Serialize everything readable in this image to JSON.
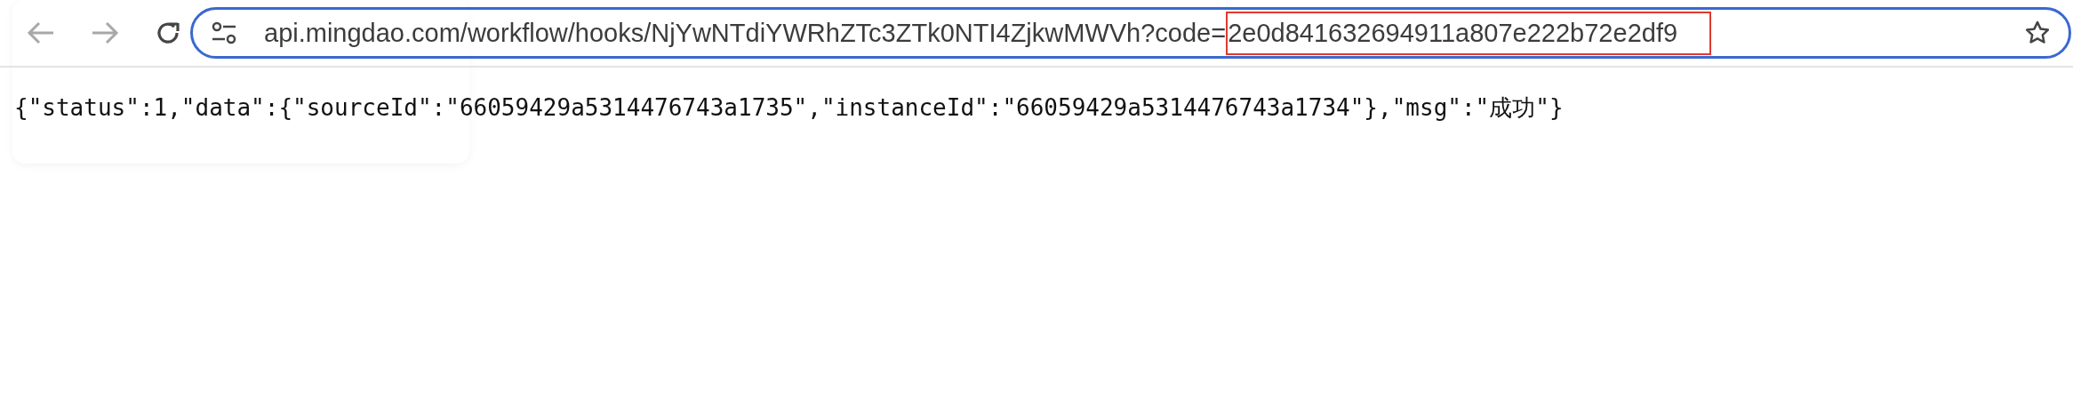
{
  "toolbar": {
    "url_prefix": "api.mingdao.com/workflow/hooks/NjYwNTdiYWRhZTc3ZTk0NTI4ZjkwMWVh?code=",
    "url_highlight": "2e0d841632694911a807e222b72e2df9"
  },
  "body": {
    "text": "{\"status\":1,\"data\":{\"sourceId\":\"66059429a5314476743a1735\",\"instanceId\":\"66059429a5314476743a1734\"},\"msg\":\"成功\"}"
  }
}
